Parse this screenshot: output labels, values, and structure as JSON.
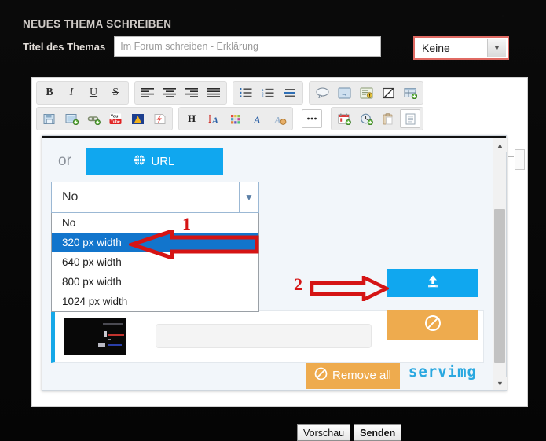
{
  "page": {
    "heading": "NEUES THEMA SCHREIBEN",
    "title_label": "Titel des Themas",
    "title_placeholder": "Im Forum schreiben - Erklärung",
    "icon_select": "Keine"
  },
  "toolbar": {
    "row1": [
      {
        "group": 1,
        "items": [
          {
            "name": "bold-icon",
            "glyph": "B"
          },
          {
            "name": "italic-icon",
            "glyph": "I"
          },
          {
            "name": "underline-icon",
            "glyph": "U"
          },
          {
            "name": "strikethrough-icon",
            "glyph": "S"
          }
        ]
      },
      {
        "group": 2,
        "items": [
          {
            "name": "align-left-icon",
            "glyph": ""
          },
          {
            "name": "align-center-icon",
            "glyph": ""
          },
          {
            "name": "align-right-icon",
            "glyph": ""
          },
          {
            "name": "align-justify-icon",
            "glyph": ""
          }
        ]
      },
      {
        "group": 3,
        "items": [
          {
            "name": "bullet-list-icon",
            "glyph": ""
          },
          {
            "name": "numbered-list-icon",
            "glyph": ""
          },
          {
            "name": "indent-icon",
            "glyph": ""
          }
        ]
      },
      {
        "group": 4,
        "items": [
          {
            "name": "quote-icon",
            "glyph": ""
          },
          {
            "name": "code-icon",
            "glyph": ""
          },
          {
            "name": "spoiler-icon",
            "glyph": ""
          },
          {
            "name": "hide-icon",
            "glyph": ""
          },
          {
            "name": "table-icon",
            "glyph": ""
          }
        ]
      }
    ],
    "row2": [
      {
        "group": 1,
        "items": [
          {
            "name": "insert-image-icon",
            "glyph": ""
          },
          {
            "name": "host-image-icon",
            "glyph": ""
          },
          {
            "name": "insert-link-icon",
            "glyph": ""
          },
          {
            "name": "youtube-icon",
            "glyph": ""
          },
          {
            "name": "dailymotion-icon",
            "glyph": ""
          },
          {
            "name": "flash-icon",
            "glyph": ""
          }
        ]
      },
      {
        "group": 2,
        "items": [
          {
            "name": "heading-icon",
            "glyph": "H"
          },
          {
            "name": "font-size-icon",
            "glyph": "A"
          },
          {
            "name": "font-color-icon",
            "glyph": ""
          },
          {
            "name": "font-family-icon",
            "glyph": "A"
          },
          {
            "name": "highlight-icon",
            "glyph": "A"
          }
        ]
      },
      {
        "group": 3,
        "items": [
          {
            "name": "more-options-icon",
            "glyph": "•••"
          }
        ]
      },
      {
        "group": 4,
        "items": [
          {
            "name": "calendar-icon",
            "glyph": ""
          },
          {
            "name": "clock-icon",
            "glyph": ""
          },
          {
            "name": "paste-icon",
            "glyph": ""
          },
          {
            "name": "page-icon",
            "glyph": ""
          }
        ]
      }
    ]
  },
  "modal": {
    "or_label": "or",
    "url_button": "URL",
    "url_icon": "globe-icon",
    "size_select_value": "No",
    "size_options": [
      {
        "label": "No",
        "selected": false
      },
      {
        "label": "320 px width",
        "selected": true
      },
      {
        "label": "640 px width",
        "selected": false
      },
      {
        "label": "800 px width",
        "selected": false
      },
      {
        "label": "1024 px width",
        "selected": false
      }
    ],
    "remove_all_label": "Remove all",
    "remove_all_icon": "no-entry-icon",
    "upload_icon": "upload-icon",
    "cancel_icon": "no-entry-icon",
    "filename_value": "",
    "brand": "servimg",
    "thumbnail": "video-thumbnail"
  },
  "annotations": [
    {
      "name": "annotation-1",
      "number": "1",
      "direction": "left",
      "points_to": "320 px width"
    },
    {
      "name": "annotation-2",
      "number": "2",
      "direction": "right",
      "points_to": "upload-button"
    }
  ],
  "footer": {
    "preview_label": "Vorschau",
    "submit_label": "Senden"
  },
  "colors": {
    "accent_blue": "#10a7ef",
    "orange": "#eeab4e",
    "select_highlight": "#1275cc",
    "annotation_red": "#d51414",
    "brand_blue": "#2aa8e0",
    "keine_border": "#e06a63"
  }
}
